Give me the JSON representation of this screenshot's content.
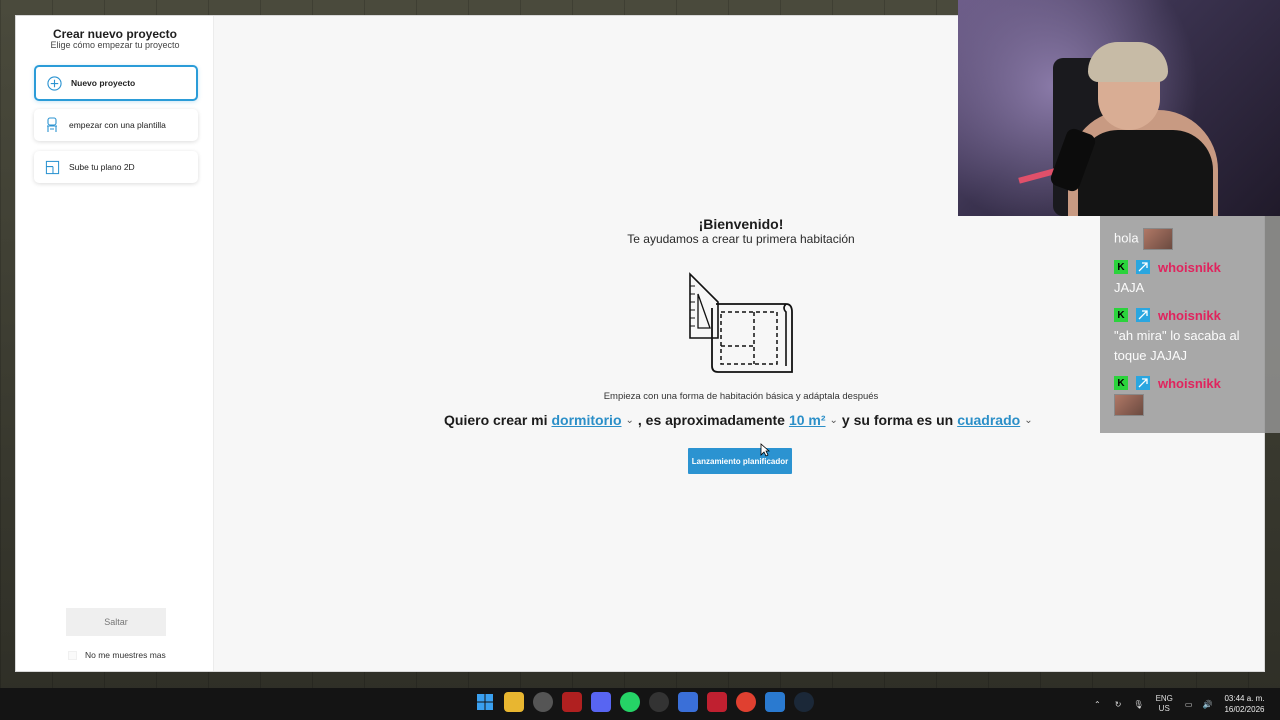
{
  "sidebar": {
    "title": "Crear nuevo proyecto",
    "subtitle": "Elige cómo empezar tu proyecto",
    "options": [
      {
        "label": "Nuevo proyecto",
        "icon": "plus-circle-icon"
      },
      {
        "label": "empezar con una plantilla",
        "icon": "chair-icon"
      },
      {
        "label": "Sube tu plano 2D",
        "icon": "floorplan-icon"
      }
    ],
    "skip_label": "Saltar",
    "dont_show_label": "No me muestres mas"
  },
  "main": {
    "welcome_title": "¡Bienvenido!",
    "welcome_subtitle": "Te ayudamos a crear tu primera habitación",
    "hint": "Empieza con una forma de habitación básica y adáptala después",
    "sentence": {
      "part1": "Quiero crear mi",
      "room_type": "dormitorio",
      "part2": ", es aproximadamente",
      "area": "10 m²",
      "part3": "y su forma es un",
      "shape": "cuadrado"
    },
    "launch_label": "Lanzamiento planificador"
  },
  "chat": {
    "messages": [
      {
        "user": "",
        "text": "hola",
        "emote": true
      },
      {
        "user": "whoisnikk",
        "text": "JAJA",
        "emote": false
      },
      {
        "user": "whoisnikk",
        "text": "\"ah mira\" lo sacaba al toque JAJAJ",
        "emote": false
      },
      {
        "user": "whoisnikk",
        "text": "",
        "emote": true
      }
    ]
  },
  "taskbar": {
    "lang_top": "ENG",
    "lang_bottom": "US",
    "time": "03:44 a. m.",
    "date": "16/02/2026"
  },
  "colors": {
    "accent": "#2b93d1",
    "chat_user": "#e0245e"
  }
}
